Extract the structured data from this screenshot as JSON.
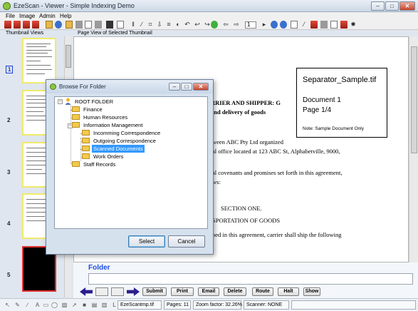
{
  "window": {
    "title": "EzeScan - Viewer - Simple Indexing Demo",
    "controls": {
      "minimize": "–",
      "maximize": "□",
      "close": "✕"
    }
  },
  "menu": [
    "File",
    "Image",
    "Admin",
    "Help"
  ],
  "toolbar": {
    "page_number": "1"
  },
  "thumbnails": {
    "label": "Thumbnail Views",
    "selected_index": "1",
    "items": [
      {
        "number": "1",
        "style": "document"
      },
      {
        "number": "2",
        "style": "document"
      },
      {
        "number": "3",
        "style": "document"
      },
      {
        "number": "4",
        "style": "document"
      },
      {
        "number": "5",
        "style": "black"
      }
    ]
  },
  "page_view": {
    "label": "Page View of Selected Thumbnail",
    "document_lines": [
      "RRIER AND SHIPPER:  G",
      "and delivery of goods",
      "ween  ABC Pty Ltd  organized",
      "al office located at 123 ABC St, Alphabetville, 9000,",
      "al covenants and promises set forth in this agreement,",
      "ws:",
      "SECTION ONE.",
      "SPORTATION OF GOODS",
      "bed in this agreement, carrier shall ship the following"
    ],
    "separator": {
      "filename": "Separator_Sample.tif",
      "document": "Document 1",
      "page": "Page 1/4",
      "note": "Note: Sample Document Only"
    }
  },
  "folder_field": {
    "label": "Folder",
    "value": ""
  },
  "actions": [
    "Submit",
    "Print",
    "Email",
    "Delete",
    "Route",
    "Halt",
    "Show"
  ],
  "status": {
    "file": "EzeScantmp.tif",
    "pages": "Pages: 11",
    "zoom": "Zoom factor: 32.26%",
    "scanner": "Scanner: NONE"
  },
  "dialog": {
    "title": "Browse For Folder",
    "tree": [
      {
        "label": "ROOT FOLDER",
        "level": 0,
        "expanded": true,
        "icon": "root-user-icon"
      },
      {
        "label": "Finance",
        "level": 1,
        "icon": "folder-icon"
      },
      {
        "label": "Human Resources",
        "level": 1,
        "icon": "folder-icon"
      },
      {
        "label": "Information Management",
        "level": 1,
        "expanded": true,
        "icon": "folder-icon"
      },
      {
        "label": "Incomming Correspondence",
        "level": 2,
        "icon": "folder-icon"
      },
      {
        "label": "Outgoing Correspondence",
        "level": 2,
        "icon": "folder-icon"
      },
      {
        "label": "Scanned Documents",
        "level": 2,
        "selected": true,
        "icon": "folder-icon"
      },
      {
        "label": "Work Orders",
        "level": 2,
        "icon": "folder-icon"
      },
      {
        "label": "Staff Records",
        "level": 1,
        "icon": "folder-icon"
      }
    ],
    "select_label": "Select",
    "cancel_label": "Cancel"
  }
}
